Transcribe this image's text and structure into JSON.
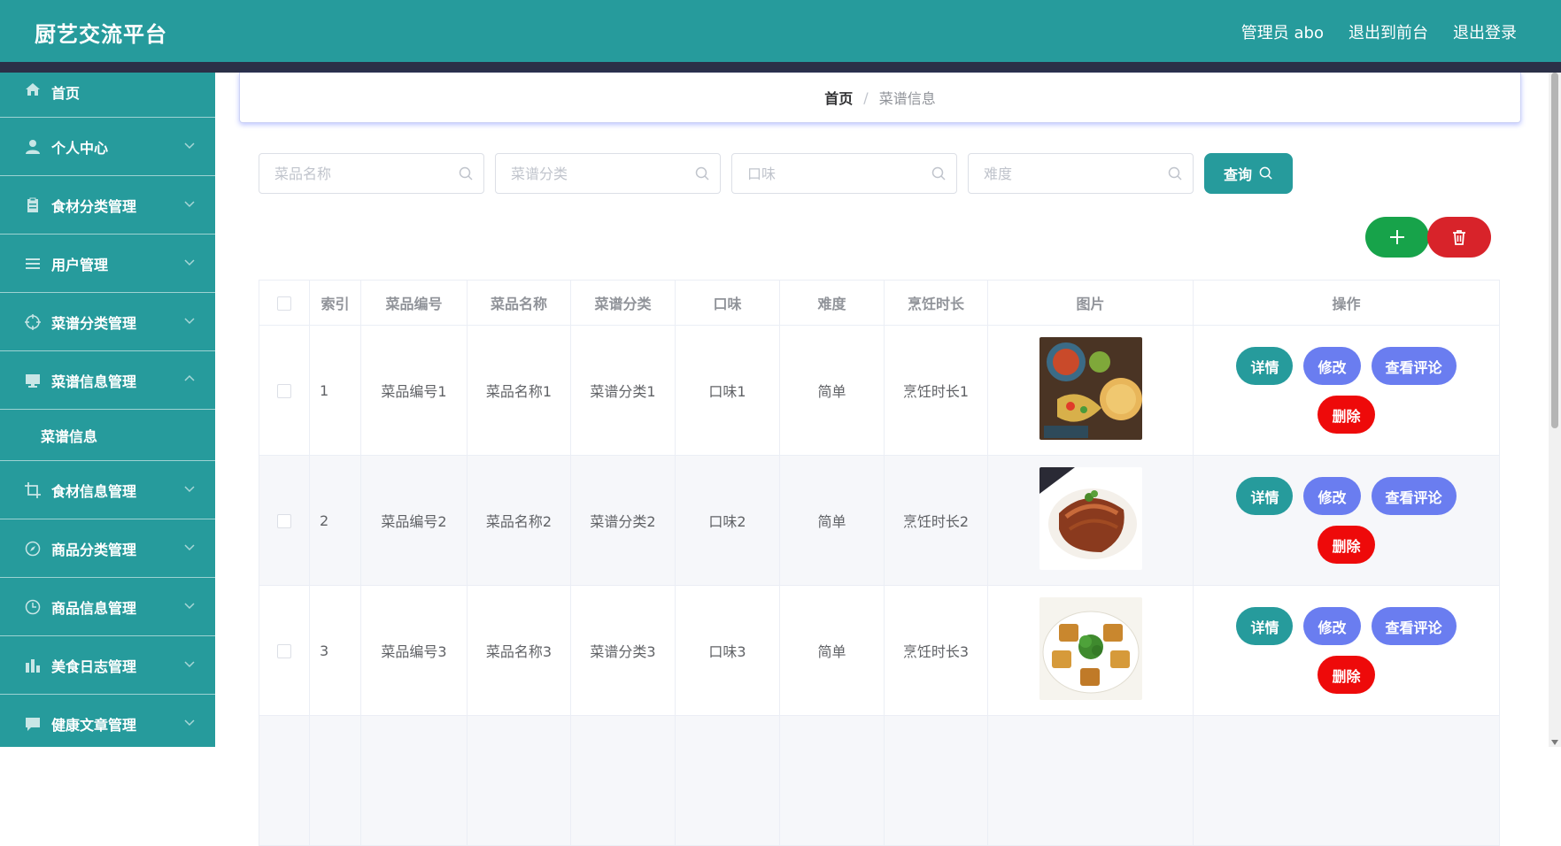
{
  "header": {
    "title": "厨艺交流平台",
    "admin_label": "管理员 abo",
    "front_label": "退出到前台",
    "logout_label": "退出登录"
  },
  "sidebar": {
    "items": [
      {
        "label": "首页",
        "icon": "home-icon"
      },
      {
        "label": "个人中心",
        "icon": "user-icon"
      },
      {
        "label": "食材分类管理",
        "icon": "clipboard-icon"
      },
      {
        "label": "用户管理",
        "icon": "list-icon"
      },
      {
        "label": "菜谱分类管理",
        "icon": "target-icon"
      },
      {
        "label": "菜谱信息管理",
        "icon": "monitor-icon"
      },
      {
        "label": "食材信息管理",
        "icon": "crop-icon"
      },
      {
        "label": "商品分类管理",
        "icon": "compass-icon"
      },
      {
        "label": "商品信息管理",
        "icon": "clock-icon"
      },
      {
        "label": "美食日志管理",
        "icon": "chart-icon"
      },
      {
        "label": "健康文章管理",
        "icon": "chat-icon"
      }
    ],
    "submenu_label": "菜谱信息"
  },
  "breadcrumb": {
    "home": "首页",
    "separator": "/",
    "current": "菜谱信息"
  },
  "search": {
    "name_placeholder": "菜品名称",
    "category_placeholder": "菜谱分类",
    "flavor_placeholder": "口味",
    "difficulty_placeholder": "难度",
    "query_label": "查询"
  },
  "table": {
    "headers": [
      "索引",
      "菜品编号",
      "菜品名称",
      "菜谱分类",
      "口味",
      "难度",
      "烹饪时长",
      "图片",
      "操作"
    ],
    "rows": [
      {
        "index": "1",
        "code": "菜品编号1",
        "name": "菜品名称1",
        "category": "菜谱分类1",
        "flavor": "口味1",
        "difficulty": "简单",
        "duration": "烹饪时长1"
      },
      {
        "index": "2",
        "code": "菜品编号2",
        "name": "菜品名称2",
        "category": "菜谱分类2",
        "flavor": "口味2",
        "difficulty": "简单",
        "duration": "烹饪时长2"
      },
      {
        "index": "3",
        "code": "菜品编号3",
        "name": "菜品名称3",
        "category": "菜谱分类3",
        "flavor": "口味3",
        "difficulty": "简单",
        "duration": "烹饪时长3"
      }
    ],
    "actions": {
      "detail": "详情",
      "edit": "修改",
      "comments": "查看评论",
      "delete": "删除"
    }
  },
  "colors": {
    "primary": "#269b9c",
    "add": "#17a34a",
    "danger": "#d8232a",
    "secondary": "#6a7df0",
    "delete": "#ee0a0a",
    "header_strip": "#2b3047"
  }
}
